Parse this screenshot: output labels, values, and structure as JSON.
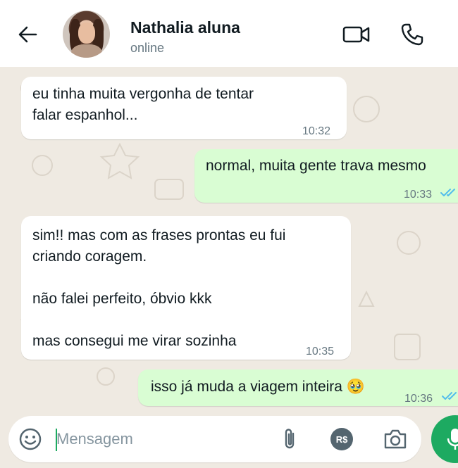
{
  "header": {
    "contact_name": "Nathalia aluna",
    "status": "online",
    "icons": {
      "back": "arrow-left-icon",
      "avatar": "contact-avatar",
      "video": "video-camera-icon",
      "call": "phone-icon"
    }
  },
  "messages": [
    {
      "direction": "incoming",
      "text": "eu tinha muita vergonha de tentar\nfalar espanhol...",
      "time": "10:32"
    },
    {
      "direction": "outgoing",
      "text": "normal, muita gente trava mesmo",
      "time": "10:33",
      "status": "read"
    },
    {
      "direction": "incoming",
      "text": "sim!! mas com as frases prontas eu fui\ncriando coragem.\n\nnão falei perfeito, óbvio kkk\n\nmas consegui me virar sozinha",
      "time": "10:35"
    },
    {
      "direction": "outgoing",
      "text": "isso já muda a viagem inteira 🥹",
      "time": "10:36",
      "status": "read"
    }
  ],
  "composer": {
    "placeholder": "Mensagem",
    "value": "",
    "pay_label": "R$",
    "icons": {
      "emoji": "emoji-icon",
      "attach": "paperclip-icon",
      "pay": "payment-icon",
      "camera": "camera-icon",
      "mic": "microphone-icon"
    }
  },
  "colors": {
    "background": "#efeae2",
    "incoming_bubble": "#ffffff",
    "outgoing_bubble": "#d9fdd3",
    "accent_green": "#1daa61",
    "read_ticks": "#53bdeb",
    "timestamp": "#667781"
  }
}
